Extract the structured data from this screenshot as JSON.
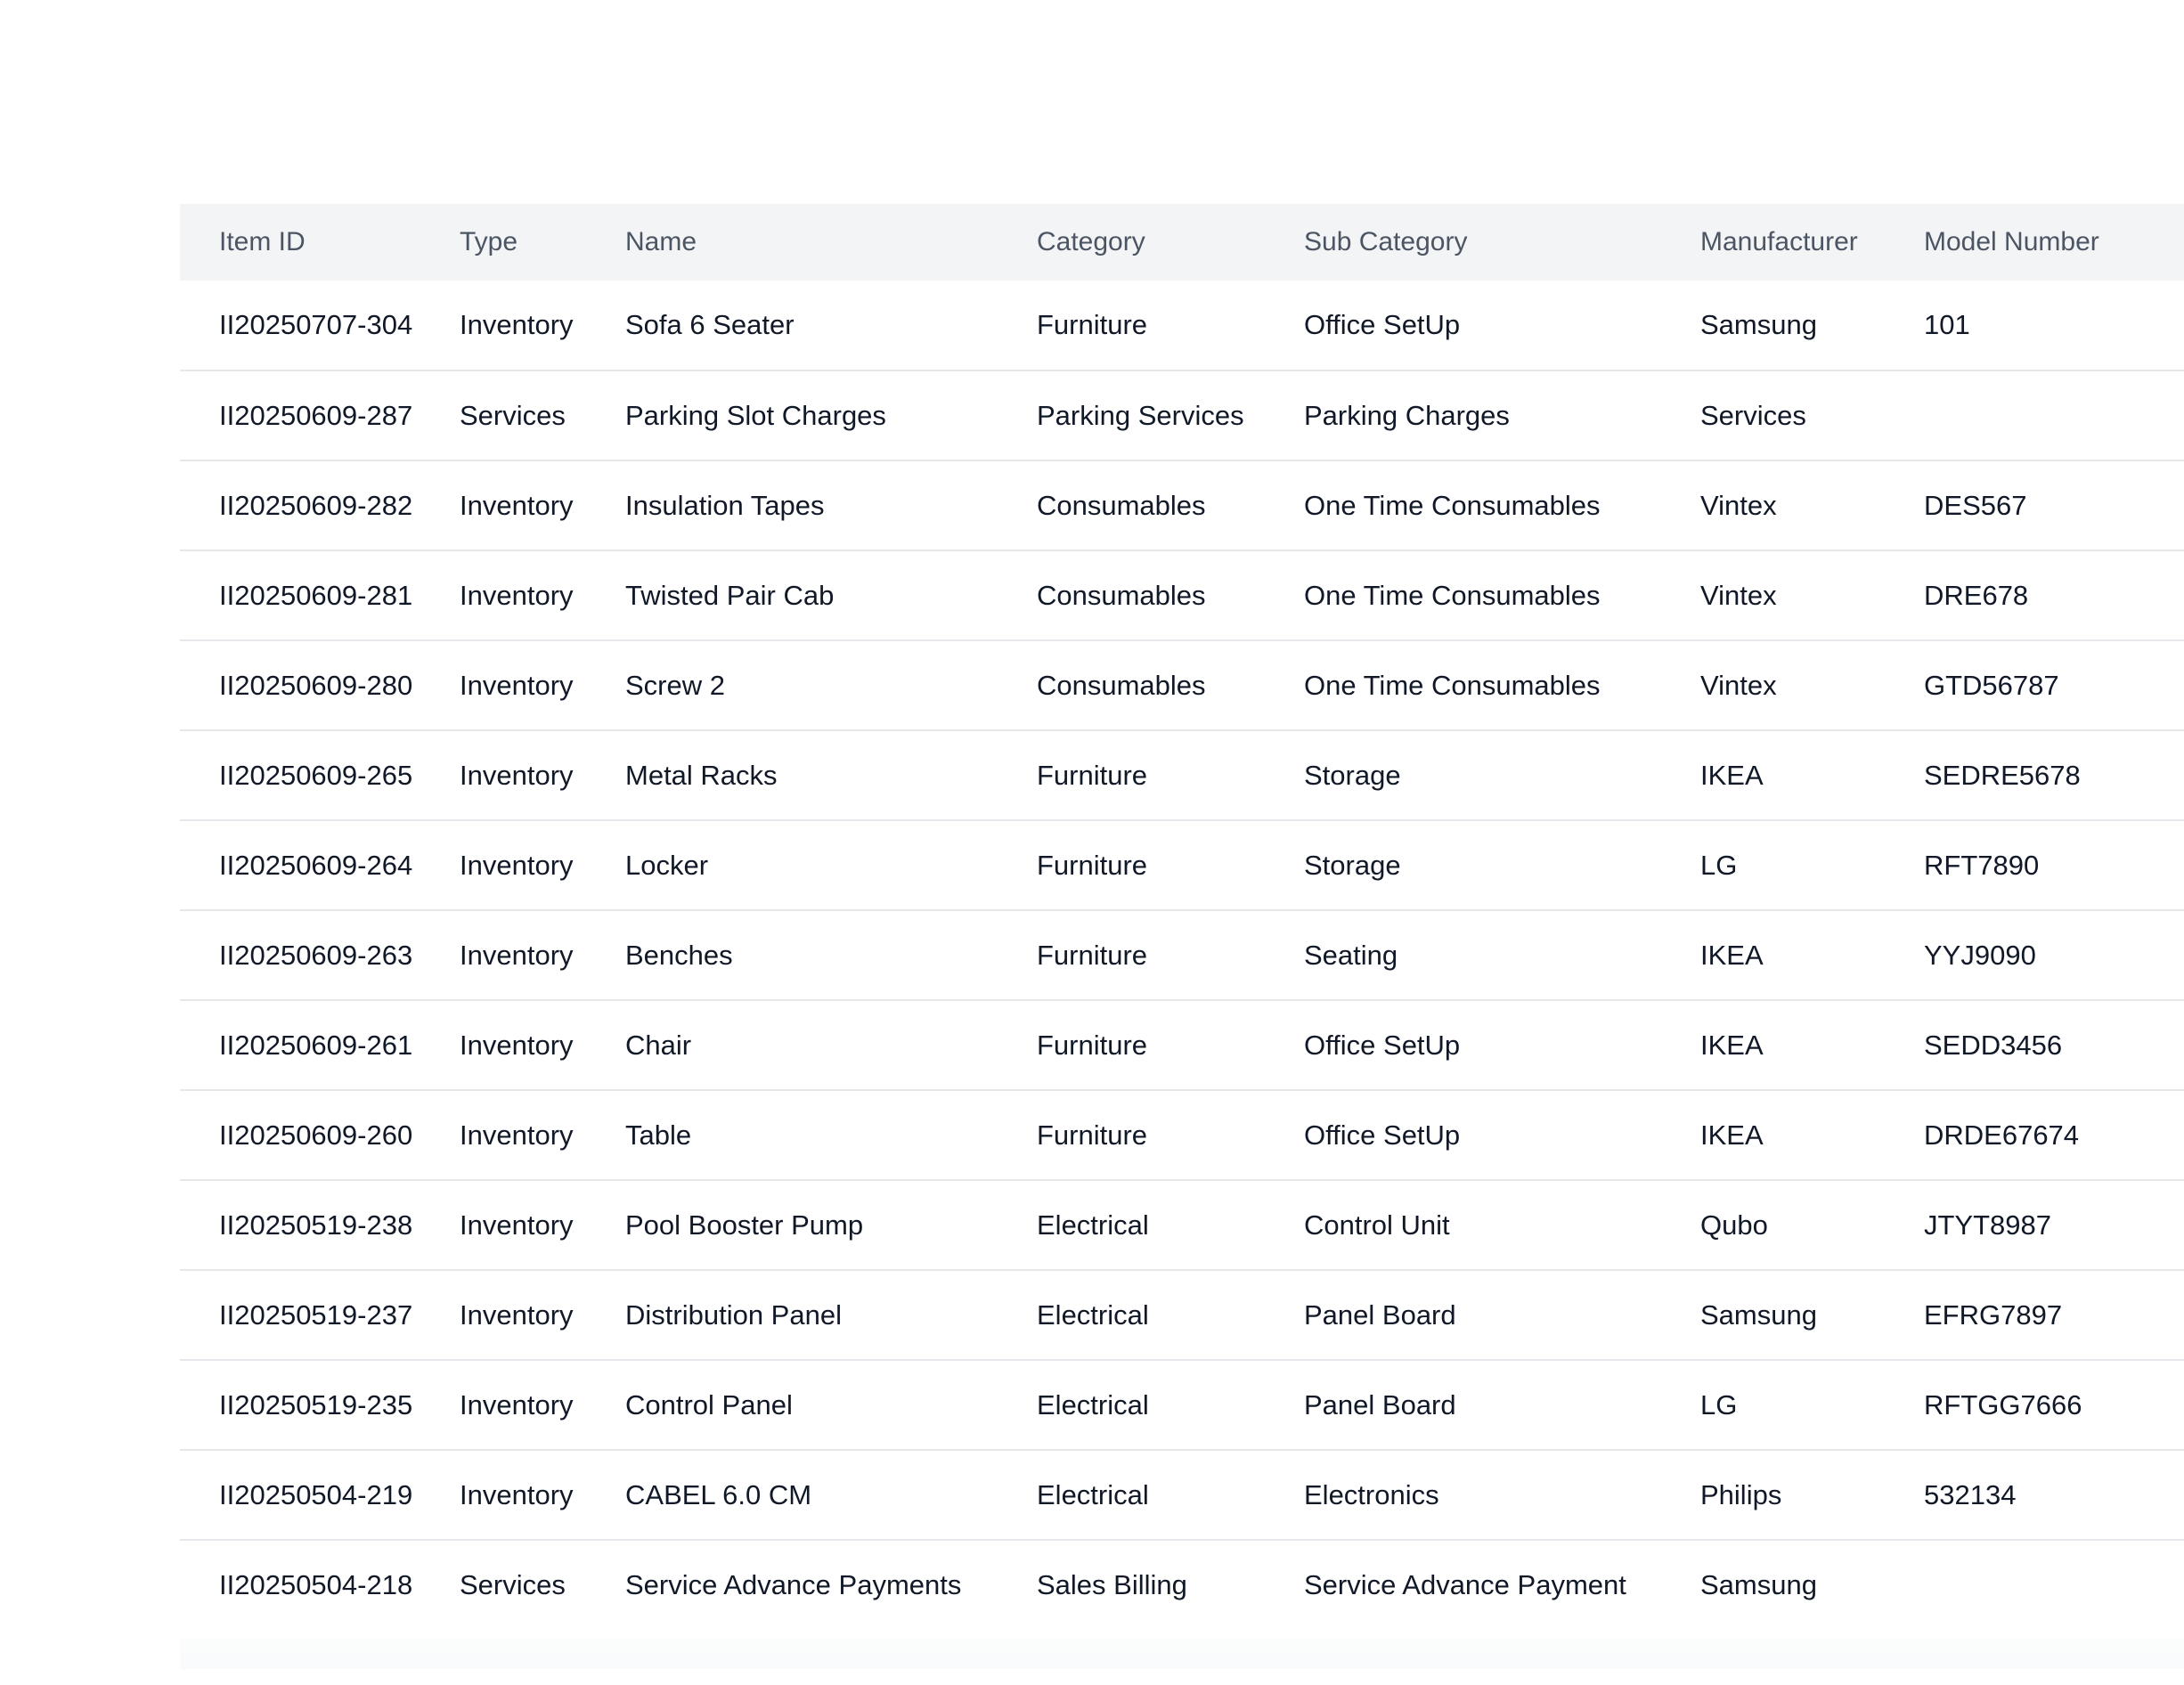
{
  "table": {
    "columns": [
      "Item ID",
      "Type",
      "Name",
      "Category",
      "Sub Category",
      "Manufacturer",
      "Model Number"
    ],
    "rows": [
      [
        "II20250707-304",
        "Inventory",
        "Sofa 6 Seater",
        "Furniture",
        "Office SetUp",
        "Samsung",
        "101"
      ],
      [
        "II20250609-287",
        "Services",
        "Parking Slot Charges",
        "Parking Services",
        "Parking Charges",
        "Services",
        ""
      ],
      [
        "II20250609-282",
        "Inventory",
        "Insulation Tapes",
        "Consumables",
        "One Time Consumables",
        "Vintex",
        "DES567"
      ],
      [
        "II20250609-281",
        "Inventory",
        "Twisted Pair Cab",
        "Consumables",
        "One Time Consumables",
        "Vintex",
        "DRE678"
      ],
      [
        "II20250609-280",
        "Inventory",
        "Screw 2",
        "Consumables",
        "One Time Consumables",
        "Vintex",
        "GTD56787"
      ],
      [
        "II20250609-265",
        "Inventory",
        "Metal Racks",
        "Furniture",
        "Storage",
        "IKEA",
        "SEDRE5678"
      ],
      [
        "II20250609-264",
        "Inventory",
        "Locker",
        "Furniture",
        "Storage",
        "LG",
        "RFT7890"
      ],
      [
        "II20250609-263",
        "Inventory",
        "Benches",
        "Furniture",
        "Seating",
        "IKEA",
        "YYJ9090"
      ],
      [
        "II20250609-261",
        "Inventory",
        "Chair",
        "Furniture",
        "Office SetUp",
        "IKEA",
        "SEDD3456"
      ],
      [
        "II20250609-260",
        "Inventory",
        "Table",
        "Furniture",
        "Office SetUp",
        "IKEA",
        "DRDE67674"
      ],
      [
        "II20250519-238",
        "Inventory",
        "Pool Booster Pump",
        "Electrical",
        "Control Unit",
        "Qubo",
        "JTYT8987"
      ],
      [
        "II20250519-237",
        "Inventory",
        "Distribution Panel",
        "Electrical",
        "Panel Board",
        "Samsung",
        "EFRG7897"
      ],
      [
        "II20250519-235",
        "Inventory",
        "Control Panel",
        "Electrical",
        "Panel Board",
        "LG",
        "RFTGG7666"
      ],
      [
        "II20250504-219",
        "Inventory",
        "CABEL 6.0 CM",
        "Electrical",
        "Electronics",
        "Philips",
        "532134"
      ],
      [
        "II20250504-218",
        "Services",
        "Service Advance Payments",
        "Sales Billing",
        "Service Advance Payment",
        "Samsung",
        ""
      ]
    ]
  },
  "colors": {
    "header_bg": "#f3f4f6",
    "header_text": "#4b5563",
    "cell_text": "#111827",
    "row_border": "#e5e7eb"
  }
}
